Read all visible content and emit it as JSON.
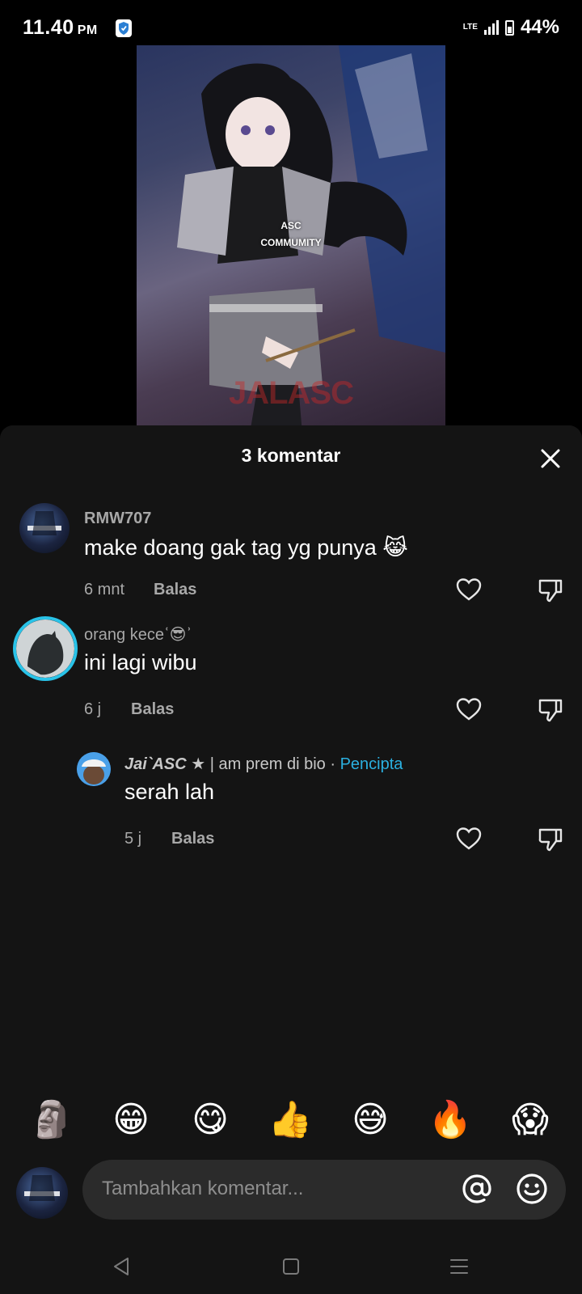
{
  "status": {
    "time": "11.40",
    "ampm": "PM",
    "network": "LTE",
    "battery": "44%"
  },
  "video": {
    "watermark_line1": "ASC",
    "watermark_line2": "COMMUMITY",
    "watermark_logo": "JALASC"
  },
  "sheet": {
    "title": "3 komentar"
  },
  "comments": [
    {
      "username": "RMW707",
      "text": "make doang gak tag yg punya",
      "emoji": "😹",
      "time": "6 mnt",
      "reply": "Balas"
    },
    {
      "username": "orang kece",
      "username_emoji": "😎",
      "text": "ini lagi wibu",
      "time": "6 j",
      "reply": "Balas"
    },
    {
      "username": "Jai`ASC",
      "username_suffix": "★ | am prem di bio ·",
      "creator_badge": "Pencipta",
      "text": "serah lah",
      "time": "5 j",
      "reply": "Balas"
    }
  ],
  "emoji_bar": [
    "🗿",
    "😁",
    "😋",
    "👍",
    "😅",
    "🔥",
    "😱"
  ],
  "input": {
    "placeholder": "Tambahkan komentar..."
  },
  "colors": {
    "sheet_bg": "#141414",
    "muted_text": "#a8a8a8",
    "creator_accent": "#2bb0e0",
    "input_bg": "#2b2b2b"
  }
}
